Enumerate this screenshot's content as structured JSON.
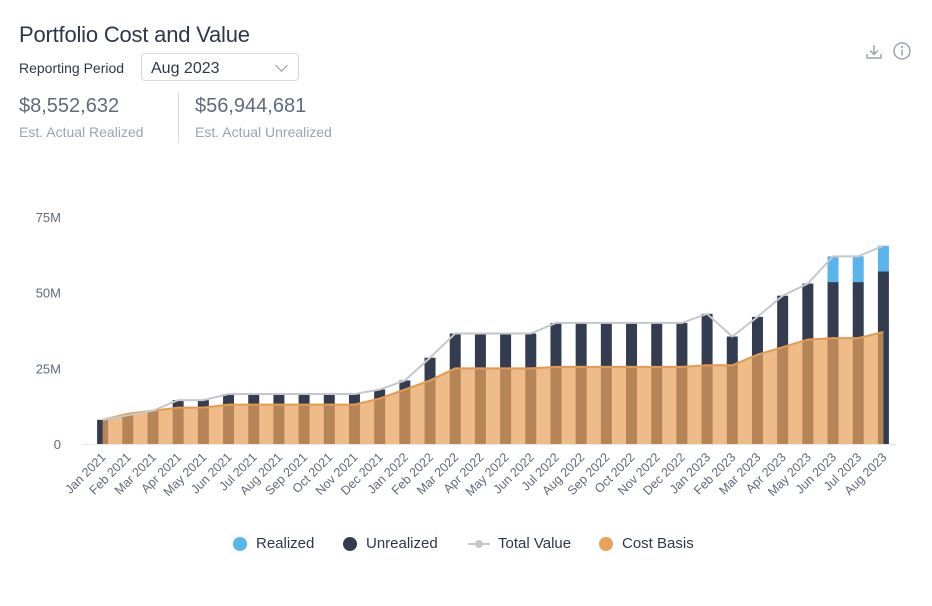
{
  "header": {
    "title": "Portfolio Cost and Value",
    "period_label": "Reporting Period",
    "period_value": "Aug 2023"
  },
  "stats": [
    {
      "value": "$8,552,632",
      "label": "Est. Actual Realized"
    },
    {
      "value": "$56,944,681",
      "label": "Est. Actual Unrealized"
    }
  ],
  "icons": [
    "download-icon",
    "info-icon",
    "chevron-down-icon"
  ],
  "chart_data": {
    "type": "bar",
    "categories": [
      "Jan 2021",
      "Feb 2021",
      "Mar 2021",
      "Apr 2021",
      "May 2021",
      "Jun 2021",
      "Jul 2021",
      "Aug 2021",
      "Sep 2021",
      "Oct 2021",
      "Nov 2021",
      "Dec 2021",
      "Jan 2022",
      "Feb 2022",
      "Mar 2022",
      "Apr 2022",
      "May 2022",
      "Jun 2022",
      "Jul 2022",
      "Aug 2022",
      "Sep 2022",
      "Oct 2022",
      "Nov 2022",
      "Dec 2022",
      "Jan 2023",
      "Feb 2023",
      "Mar 2023",
      "Apr 2023",
      "May 2023",
      "Jun 2023",
      "Jul 2023",
      "Aug 2023"
    ],
    "series": [
      {
        "name": "Realized",
        "type": "bar",
        "color": "#5ab4ec",
        "values": [
          0,
          0,
          0,
          0,
          0,
          0,
          0,
          0,
          0,
          0,
          0,
          0,
          0,
          0,
          0,
          0,
          0,
          0,
          0,
          0,
          0,
          0,
          0,
          0,
          0,
          0,
          0,
          0,
          0,
          8.5,
          8.5,
          8.5
        ]
      },
      {
        "name": "Unrealized",
        "type": "bar",
        "color": "#343d50",
        "values": [
          8,
          9.5,
          11,
          14.5,
          14.5,
          16.5,
          16.5,
          16.5,
          16.5,
          16.5,
          16.5,
          18,
          21,
          28.5,
          36.5,
          36.5,
          36.5,
          36.5,
          40,
          40,
          40,
          40,
          40,
          40,
          43,
          35.5,
          42,
          49,
          53,
          53.5,
          53.5,
          57
        ]
      },
      {
        "name": "Total Value",
        "type": "line",
        "color": "#c5c7cb",
        "values": [
          8,
          9.5,
          11,
          14.5,
          14.5,
          16.5,
          16.5,
          16.5,
          16.5,
          16.5,
          16.5,
          18,
          21,
          28.5,
          36.5,
          36.5,
          36.5,
          36.5,
          40,
          40,
          40,
          40,
          40,
          40,
          43,
          35.5,
          42,
          49,
          53,
          62,
          62,
          65.5
        ]
      },
      {
        "name": "Cost Basis",
        "type": "area",
        "color": "#e9a15a",
        "values": [
          8,
          10,
          11,
          12,
          12,
          13,
          13,
          13,
          13,
          13,
          13,
          15,
          18,
          21,
          25,
          25,
          25,
          25,
          25.5,
          25.5,
          25.5,
          25.5,
          25.5,
          25.5,
          26,
          26,
          29.5,
          32,
          34.5,
          35,
          35,
          37
        ]
      }
    ],
    "yticks": [
      "0",
      "25M",
      "50M",
      "75M"
    ],
    "ylim": [
      0,
      75
    ],
    "legend_position": "bottom",
    "grid": false
  }
}
